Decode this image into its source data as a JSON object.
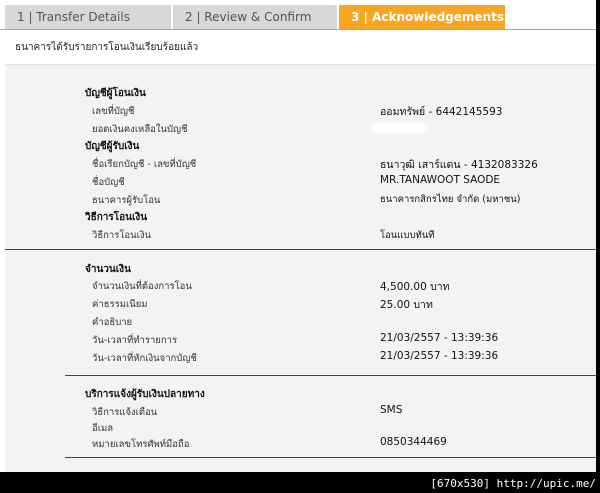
{
  "tabs": [
    {
      "label": "1 | Transfer Details"
    },
    {
      "label": "2 | Review & Confirm"
    },
    {
      "label": "3 | Acknowledgements"
    }
  ],
  "notice": "ธนาคารได้รับรายการโอนเงินเรียบร้อยแล้ว",
  "from_account": {
    "header": "บัญชีผู้โอนเงิน",
    "account_no_label": "เลขที่บัญชี",
    "account_no_value": "ออมทรัพย์ - 6442145593",
    "balance_label": "ยอดเงินคงเหลือในบัญชี"
  },
  "to_account": {
    "header": "บัญชีผู้รับเงิน",
    "nickname_label": "ชื่อเรียกบัญชี - เลขที่บัญชี",
    "nickname_value": "ธนาวุฒิ เสาร์แดน - 4132083326",
    "name_label": "ชื่อบัญชี",
    "name_value": "MR.TANAWOOT SAODE",
    "bank_label": "ธนาคารผู้รับโอน",
    "bank_value": "ธนาคารกสิกรไทย จำกัด (มหาชน)"
  },
  "method": {
    "header": "วิธีการโอนเงิน",
    "label": "วิธีการโอนเงิน",
    "value": "โอนแบบทันที"
  },
  "amount": {
    "header": "จำนวนเงิน",
    "amount_label": "จำนวนเงินที่ต้องการโอน",
    "amount_value": "4,500.00 บาท",
    "fee_label": "ค่าธรรมเนียม",
    "fee_value": "25.00  บาท",
    "memo_label": "คำอธิบาย",
    "txn_date_label": "วัน-เวลาที่ทำรายการ",
    "txn_date_value": "21/03/2557 - 13:39:36",
    "debit_date_label": "วัน-เวลาที่หักเงินจากบัญชี",
    "debit_date_value": "21/03/2557 - 13:39:36"
  },
  "notify": {
    "header": "บริการแจ้งผู้รับเงินปลายทาง",
    "method_label": "วิธีการแจ้งเตือน",
    "method_value": "SMS",
    "email_label": "อีเมล",
    "phone_label": "หมายเลขโทรศัพท์มือถือ",
    "phone_value": "0850344469"
  },
  "watermark": "[670x530] http://upic.me/",
  "colors": {
    "active_tab": "#f6a623",
    "inactive_tab": "#d8d8d8"
  }
}
